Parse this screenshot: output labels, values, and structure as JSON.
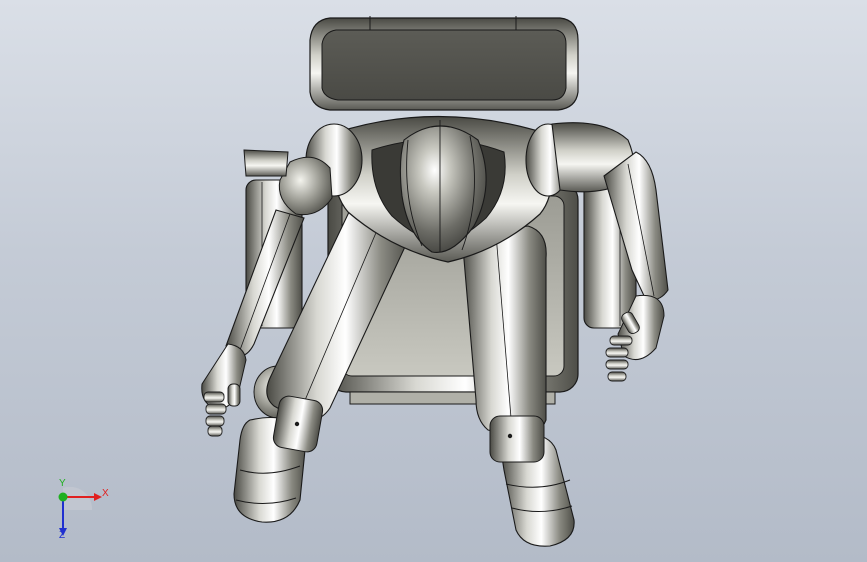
{
  "view": {
    "background_top": "#dadfe7",
    "background_bottom": "#b3bbc8",
    "model_color": "#8c8c84",
    "edge_color": "#1a1a1a"
  },
  "triad": {
    "x_label": "X",
    "y_label": "Y",
    "z_label": "Z",
    "x_color": "#e02020",
    "y_color": "#20b020",
    "z_color": "#2030d0"
  }
}
